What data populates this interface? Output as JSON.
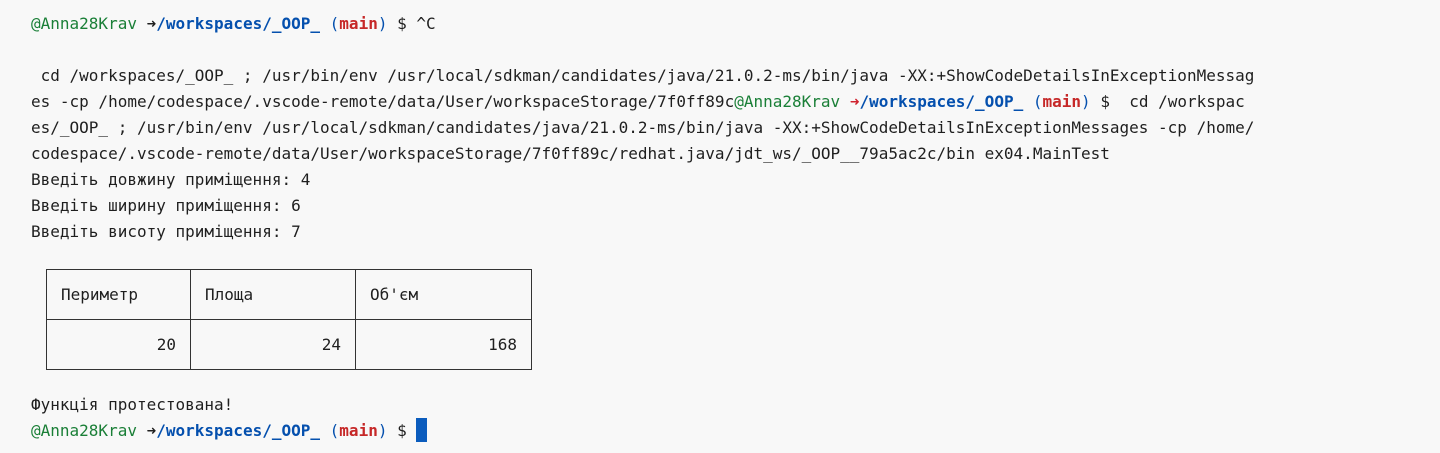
{
  "prompt": {
    "user": "@Anna28Krav",
    "arrow": "➜",
    "path": "/workspaces/_OOP_",
    "paren_open": "(",
    "branch": "main",
    "paren_close": ")",
    "symbol": "$"
  },
  "lines": {
    "first_cmd": "^C",
    "cmd_line1": " cd /workspaces/_OOP_ ; /usr/bin/env /usr/local/sdkman/candidates/java/21.0.2-ms/bin/java -XX:+ShowCodeDetailsInExceptionMessag",
    "cmd_line2_pre": "es -cp /home/codespace/.vscode-remote/data/User/workspaceStorage/7f0ff89c",
    "cmd_line2_post": "  cd /workspac",
    "cmd_line3": "es/_OOP_ ; /usr/bin/env /usr/local/sdkman/candidates/java/21.0.2-ms/bin/java -XX:+ShowCodeDetailsInExceptionMessages -cp /home/",
    "cmd_line4": "codespace/.vscode-remote/data/User/workspaceStorage/7f0ff89c/redhat.java/jdt_ws/_OOP__79a5ac2c/bin ex04.MainTest",
    "input_length": "Введіть довжину приміщення: 4",
    "input_width": "Введіть ширину приміщення: 6",
    "input_height": "Введіть висоту приміщення: 7",
    "tested": "Функція протестована!"
  },
  "table": {
    "headers": [
      "Периметр",
      "Площа",
      "Об'єм"
    ],
    "values": [
      "20",
      "24",
      "168"
    ]
  }
}
